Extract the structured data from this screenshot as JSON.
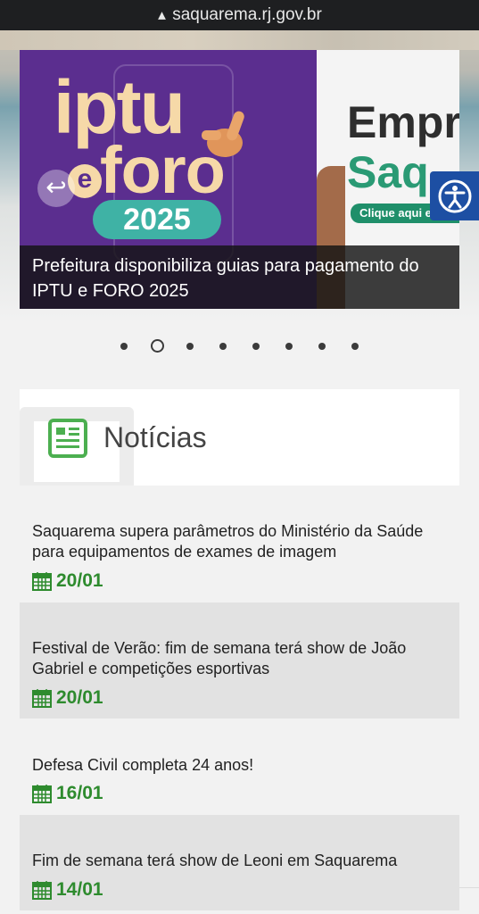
{
  "browser": {
    "url": "saquarema.rj.gov.br"
  },
  "carousel": {
    "slide": {
      "badge_line1": "iptu",
      "badge_e": "e",
      "badge_line2": "foro",
      "badge_year": "2025",
      "side_line1": "Empr",
      "side_line2": "Saq",
      "side_button": "Clique aqui e",
      "caption": "Prefeitura disponibiliza guias para pagamento do IPTU e FORO 2025"
    },
    "dot_count": 8,
    "active_index": 1
  },
  "news": {
    "title": "Notícias",
    "items": [
      {
        "title": "Saquarema supera parâmetros do Ministério da Saúde para equipamentos de exames de imagem",
        "date": "20/01"
      },
      {
        "title": "Festival de Verão: fim de semana terá show de João Gabriel e competições esportivas",
        "date": "20/01"
      },
      {
        "title": "Defesa Civil completa 24 anos!",
        "date": "16/01"
      },
      {
        "title": "Fim de semana terá show de Leoni em Saquarema",
        "date": "14/01"
      }
    ]
  },
  "colors": {
    "accent_green": "#2e8b2e",
    "accessibility_blue": "#1d4fa3",
    "slide_purple": "#5b2e8f"
  }
}
